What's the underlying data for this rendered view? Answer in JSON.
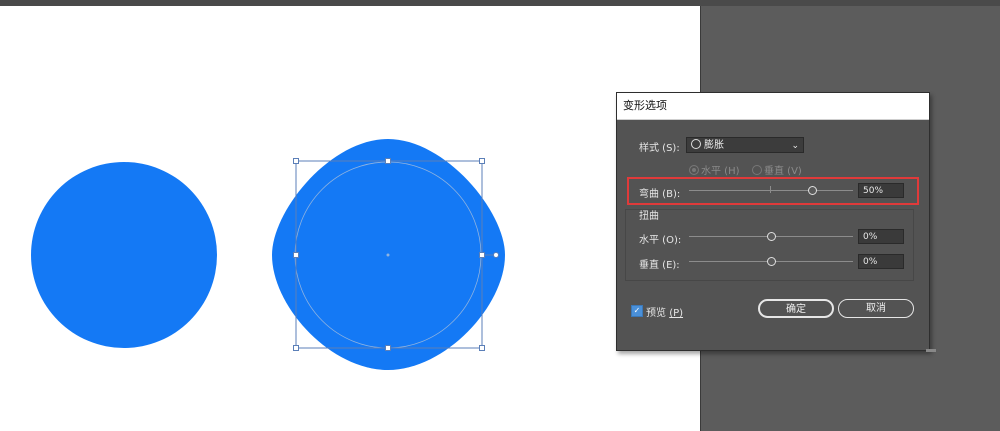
{
  "dialog": {
    "title": "变形选项",
    "style_label": "样式 (S):",
    "style_value": "膨胀",
    "orientation_horizontal": "水平 (H)",
    "orientation_vertical": "垂直 (V)",
    "bend_label": "弯曲 (B):",
    "bend_value": "50%",
    "bend_fraction": 0.75,
    "distortion_header": "扭曲",
    "horizontal_label": "水平 (O):",
    "horizontal_value": "0%",
    "horizontal_fraction": 0.5,
    "vertical_label": "垂直 (E):",
    "vertical_value": "0%",
    "vertical_fraction": 0.5,
    "preview_label": "预览",
    "preview_key": "(P)",
    "preview_checked": true,
    "ok_label": "确定",
    "cancel_label": "取消"
  },
  "colors": {
    "shape_fill": "#1479f5",
    "selection": "#5b7fb8",
    "highlight": "#e03a3a",
    "workspace": "#5c5c5c",
    "dialog_bg": "#535353"
  }
}
